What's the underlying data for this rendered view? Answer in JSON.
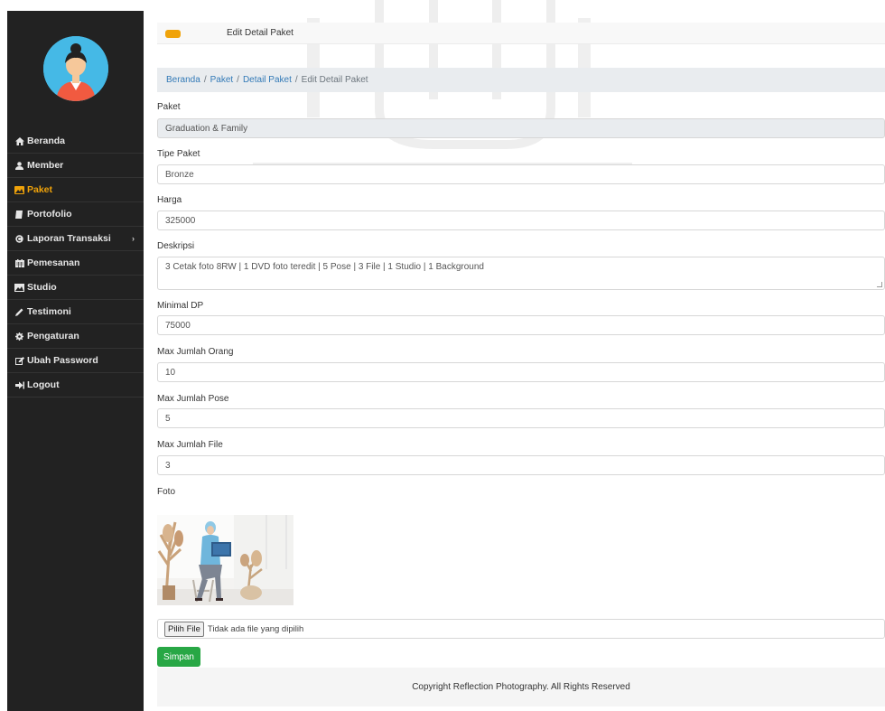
{
  "sidebar": {
    "items": [
      {
        "label": "Beranda",
        "icon": "home-icon"
      },
      {
        "label": "Member",
        "icon": "user-icon"
      },
      {
        "label": "Paket",
        "icon": "image-icon"
      },
      {
        "label": "Portofolio",
        "icon": "book-icon"
      },
      {
        "label": "Laporan Transaksi",
        "icon": "copyright-icon"
      },
      {
        "label": "Pemesanan",
        "icon": "calendar-icon"
      },
      {
        "label": "Studio",
        "icon": "photo-icon"
      },
      {
        "label": "Testimoni",
        "icon": "pencil-icon"
      },
      {
        "label": "Pengaturan",
        "icon": "gear-icon"
      },
      {
        "label": "Ubah Password",
        "icon": "edit-icon"
      },
      {
        "label": "Logout",
        "icon": "logout-icon"
      }
    ],
    "active": "Paket",
    "accent": "#f0a30a"
  },
  "header": {
    "title": "Edit Detail Paket"
  },
  "breadcrumb": {
    "items": [
      "Beranda",
      "Paket",
      "Detail Paket"
    ],
    "current": "Edit Detail Paket",
    "separator": "/"
  },
  "form": {
    "paket": {
      "label": "Paket",
      "value": "Graduation & Family"
    },
    "tipe_paket": {
      "label": "Tipe Paket",
      "value": "Bronze"
    },
    "harga": {
      "label": "Harga",
      "value": "325000"
    },
    "deskripsi": {
      "label": "Deskripsi",
      "value": "3 Cetak foto 8RW | 1 DVD foto teredit | 5 Pose | 3 File | 1 Studio | 1 Background"
    },
    "minimal_dp": {
      "label": "Minimal DP",
      "value": "75000"
    },
    "max_orang": {
      "label": "Max Jumlah Orang",
      "value": "10"
    },
    "max_pose": {
      "label": "Max Jumlah Pose",
      "value": "5"
    },
    "max_file": {
      "label": "Max Jumlah File",
      "value": "3"
    },
    "foto": {
      "label": "Foto"
    },
    "file_input": {
      "button": "Pilih File",
      "status": "Tidak ada file yang dipilih"
    },
    "submit": "Simpan"
  },
  "footer": {
    "text": "Copyright Reflection Photography. All Rights Reserved"
  },
  "colors": {
    "sidebar_bg": "#222222",
    "accent": "#f0a30a",
    "link": "#337ab7",
    "success": "#28a745"
  }
}
